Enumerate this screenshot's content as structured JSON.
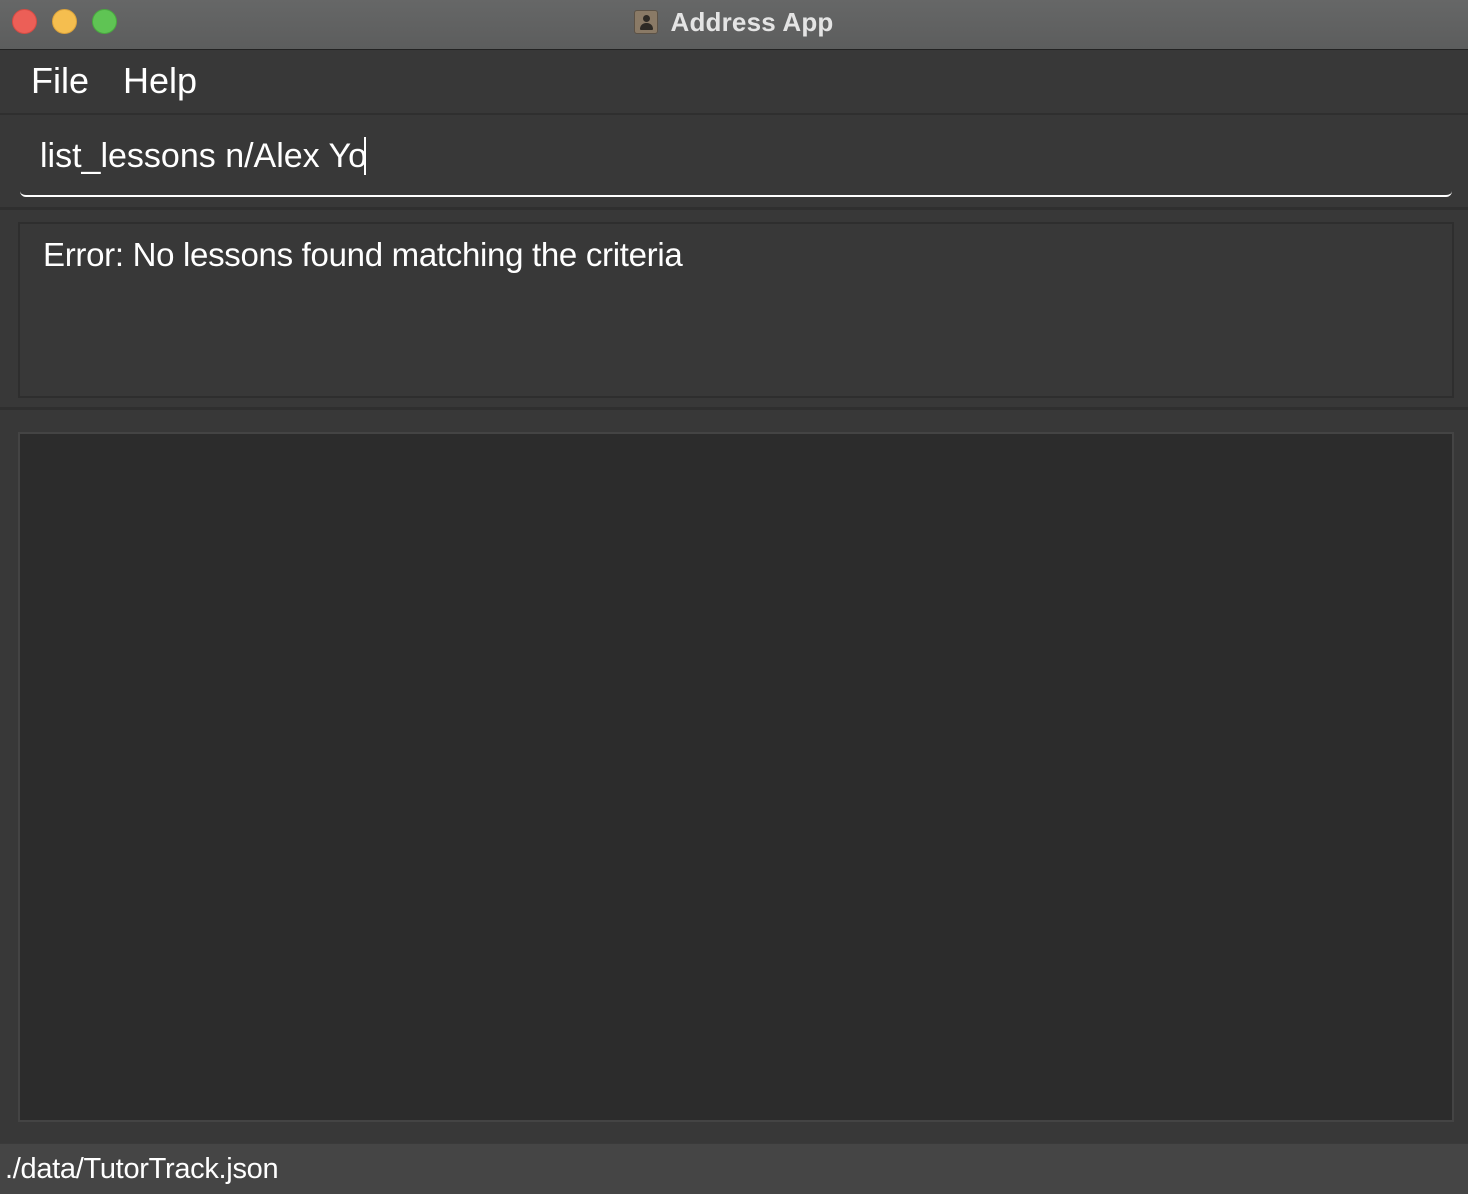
{
  "window": {
    "title": "Address App",
    "app_icon": "address-book-icon"
  },
  "menu": {
    "items": [
      {
        "label": "File"
      },
      {
        "label": "Help"
      }
    ]
  },
  "command": {
    "value": "list_lessons n/Alex Yo"
  },
  "result": {
    "message": "Error: No lessons found matching the criteria"
  },
  "list": {
    "items": []
  },
  "status": {
    "file_path": "./data/TutorTrack.json"
  },
  "colors": {
    "background": "#383838",
    "list_background": "#2c2c2c",
    "text": "#ffffff",
    "close": "#ec5f57",
    "minimize": "#f5be4f",
    "zoom": "#5fc454"
  }
}
